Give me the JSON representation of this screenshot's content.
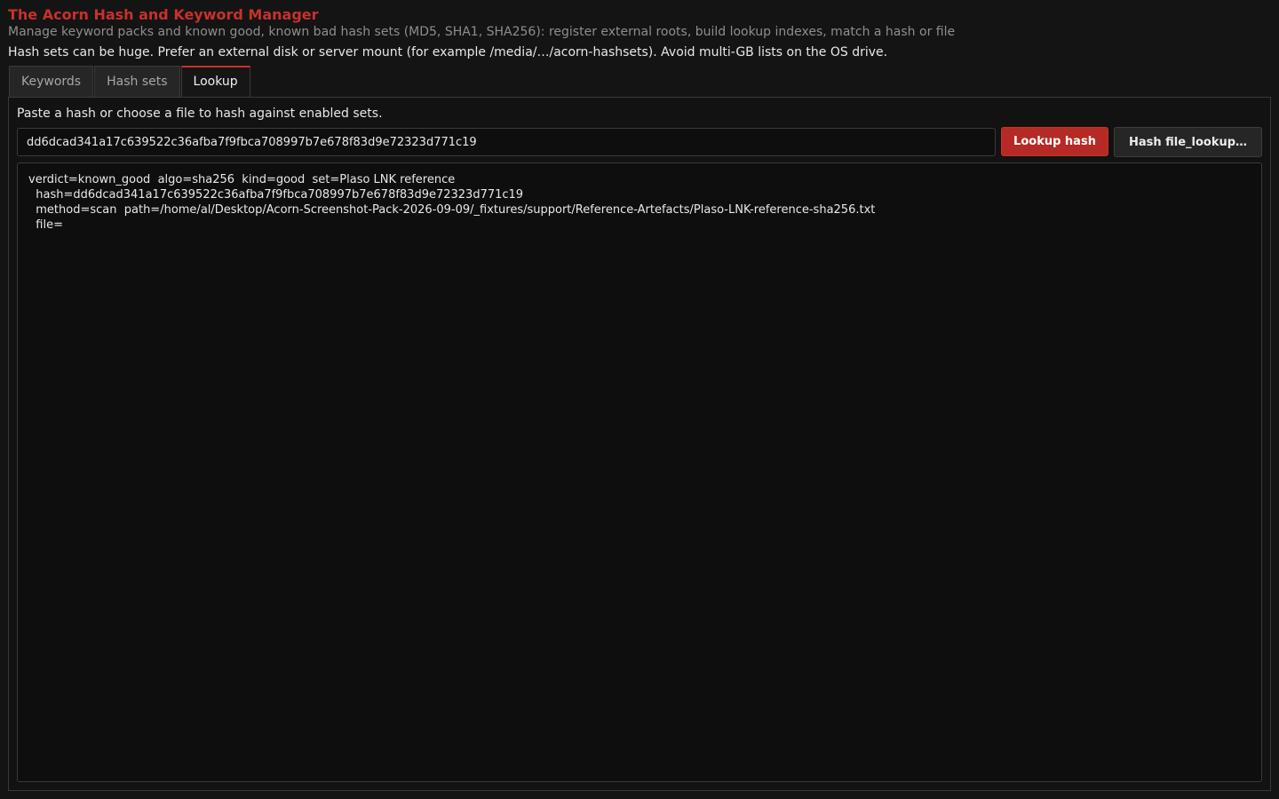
{
  "header": {
    "title": "The Acorn Hash and Keyword Manager",
    "subtitle": "Manage keyword packs and known good, known bad hash sets (MD5, SHA1, SHA256): register external roots, build lookup indexes, match a hash or file",
    "notice": "Hash sets can be huge. Prefer an external disk or server mount (for example /media/…/acorn-hashsets). Avoid multi-GB lists on the OS drive."
  },
  "tabs": [
    {
      "label": "Keywords",
      "active": false
    },
    {
      "label": "Hash sets",
      "active": false
    },
    {
      "label": "Lookup",
      "active": true
    }
  ],
  "lookup": {
    "instructions": "Paste a hash or choose a file to hash against enabled sets.",
    "hash_value": "dd6dcad341a17c639522c36afba7f9fbca708997b7e678f83d9e72323d771c19",
    "lookup_button": "Lookup hash",
    "file_button": "Hash file_lookup…",
    "result_lines": [
      "verdict=known_good  algo=sha256  kind=good  set=Plaso LNK reference",
      "  hash=dd6dcad341a17c639522c36afba7f9fbca708997b7e678f83d9e72323d771c19",
      "  method=scan  path=/home/al/Desktop/Acorn-Screenshot-Pack-2026-09-09/_fixtures/support/Reference-Artefacts/Plaso-LNK-reference-sha256.txt",
      "  file="
    ]
  },
  "colors": {
    "accent": "#c8312a",
    "background": "#141414",
    "text": "#e8e8e8",
    "muted_text": "#8e8e8e"
  }
}
